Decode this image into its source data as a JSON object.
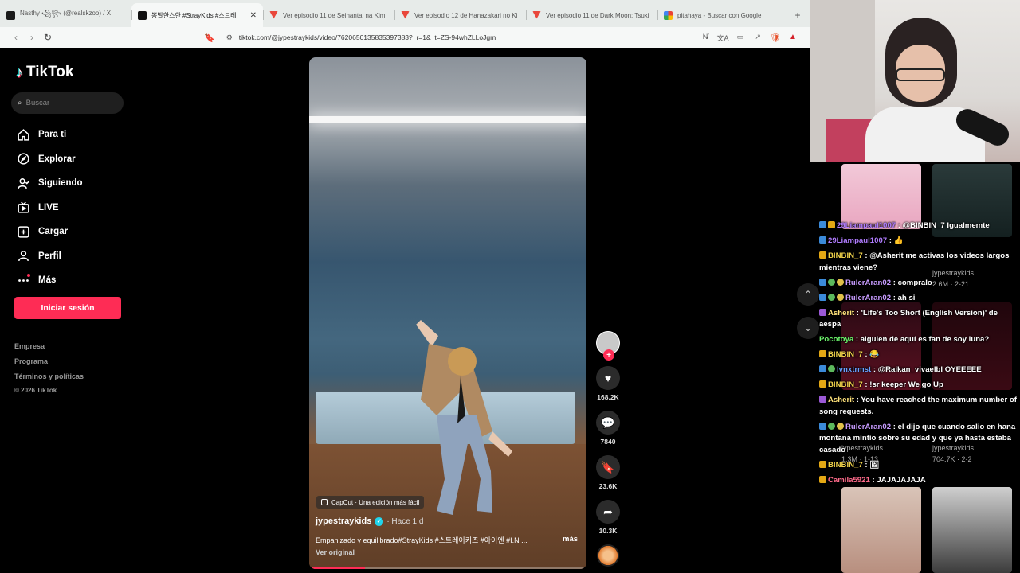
{
  "browser": {
    "tabs": [
      {
        "title": "Nasthy ꧁꧂ (@realskzoo) / X",
        "fav": "fav-x",
        "active": false
      },
      {
        "title": "뽕발한스한 #StrayKids #스트레",
        "fav": "fav-tt",
        "active": true
      },
      {
        "title": "Ver episodio 11 de Seihantai na Kim",
        "fav": "fav-fl",
        "active": false
      },
      {
        "title": "Ver episodio 12 de Hanazakari no Ki",
        "fav": "fav-fl",
        "active": false
      },
      {
        "title": "Ver episodio 11 de Dark Moon: Tsuki",
        "fav": "fav-fl",
        "active": false
      },
      {
        "title": "pitahaya - Buscar con Google",
        "fav": "fav-g",
        "active": false
      }
    ],
    "close_glyph": "✕",
    "new_tab_glyph": "+",
    "url": "tiktok.com/@jypestraykids/video/7620650135835397383?_r=1&_t=ZS-94whZLLoJgm",
    "back_glyph": "‹",
    "forward_glyph": "›",
    "reload_glyph": "↻",
    "bookmark_glyph": "🔖",
    "site_info_glyph": "⚙",
    "extensions": [
      "N̸",
      "文A",
      "▭",
      "↗",
      "🛡",
      "▲"
    ]
  },
  "tiktok": {
    "logo": "TikTok",
    "logo_glyph": "♪",
    "search_placeholder": "Buscar",
    "search_glyph": "⌕",
    "nav": [
      {
        "label": "Para ti",
        "icon": "home-icon"
      },
      {
        "label": "Explorar",
        "icon": "compass-icon"
      },
      {
        "label": "Siguiendo",
        "icon": "following-icon"
      },
      {
        "label": "LIVE",
        "icon": "live-icon"
      },
      {
        "label": "Cargar",
        "icon": "upload-icon"
      },
      {
        "label": "Perfil",
        "icon": "profile-icon"
      },
      {
        "label": "Más",
        "icon": "more-icon"
      }
    ],
    "login_button": "Iniciar sesión",
    "footer": {
      "company": "Empresa",
      "program": "Programa",
      "terms": "Términos y políticas",
      "copyright": "© 2026 TikTok"
    },
    "video": {
      "capcut_label": "CapCut · Una edición más fácil",
      "author": "jypestraykids",
      "verified_glyph": "✓",
      "time": "· Hace 1 d",
      "description": "Empanizado y equilibrado#StrayKids #스트레이키즈 #아이엔 #I.N ...",
      "more": "más",
      "original": "Ver original",
      "progress": 0.2
    },
    "actions": {
      "follow_glyph": "+",
      "like_glyph": "♥",
      "likes": "168.2K",
      "comment_glyph": "💬",
      "comments": "7840",
      "save_glyph": "🔖",
      "saves": "23.6K",
      "share_glyph": "➦",
      "shares": "10.3K"
    }
  },
  "stream": {
    "arrow_up": "⌃",
    "arrow_down": "⌄",
    "thumbs": [
      {
        "author": "jypestraykids",
        "meta": "2.6M · 2-21"
      },
      {
        "author": "jypestraykids",
        "meta": "1.3M · 1-13"
      },
      {
        "author": "jypestraykids",
        "meta": "704.7K · 2-2"
      }
    ],
    "chat": [
      {
        "badges": [
          "b-blue",
          "b-gold"
        ],
        "user": "29Liampaul1007",
        "color": "#b07cff",
        "text": "@BINBIN_7 Igualmemte"
      },
      {
        "badges": [
          "b-blue"
        ],
        "user": "29Liampaul1007",
        "color": "#b07cff",
        "text": "👍"
      },
      {
        "badges": [
          "b-gold"
        ],
        "user": "BINBIN_7",
        "color": "#f0d24a",
        "text": "@Asherit me activas los videos largos mientras viene?"
      },
      {
        "badges": [
          "b-blue",
          "b-green",
          "b-sub"
        ],
        "user": "RulerAran02",
        "color": "#c79bff",
        "text": "compralo"
      },
      {
        "badges": [
          "b-blue",
          "b-green",
          "b-sub"
        ],
        "user": "RulerAran02",
        "color": "#c79bff",
        "text": "ah si"
      },
      {
        "badges": [
          "b-purple"
        ],
        "user": "Asherit",
        "color": "#ffe27a",
        "text": "'Life's Too Short (English Version)' de aespa"
      },
      {
        "badges": [],
        "user": "Pocotoya",
        "color": "#6bf56b",
        "text": "alguien de aquí es fan de soy luna?"
      },
      {
        "badges": [
          "b-gold"
        ],
        "user": "BINBIN_7",
        "color": "#f0d24a",
        "text": "😂"
      },
      {
        "badges": [
          "b-blue",
          "b-green"
        ],
        "user": "lvnxtrmst",
        "color": "#6aa0ff",
        "text": "@Raikan_vivaelbl OYEEEEE"
      },
      {
        "badges": [
          "b-gold"
        ],
        "user": "BINBIN_7",
        "color": "#f0d24a",
        "text": "!sr keeper We go Up"
      },
      {
        "badges": [
          "b-purple"
        ],
        "user": "Asherit",
        "color": "#ffe27a",
        "text": "You have reached the maximum number of song requests."
      },
      {
        "badges": [
          "b-blue",
          "b-green",
          "b-sub"
        ],
        "user": "RulerAran02",
        "color": "#c79bff",
        "text": "el dijo que cuando salio en hana montana mintio sobre su edad y que ya hasta estaba casado"
      },
      {
        "badges": [
          "b-gold"
        ],
        "user": "BINBIN_7",
        "color": "#f0d24a",
        "text": "🖼"
      },
      {
        "badges": [
          "b-gold"
        ],
        "user": "Camila5921",
        "color": "#ff6b8b",
        "text": "JAJAJAJAJA"
      }
    ]
  },
  "colors": {
    "accent": "#fe2c55",
    "verified": "#20d5ec"
  }
}
